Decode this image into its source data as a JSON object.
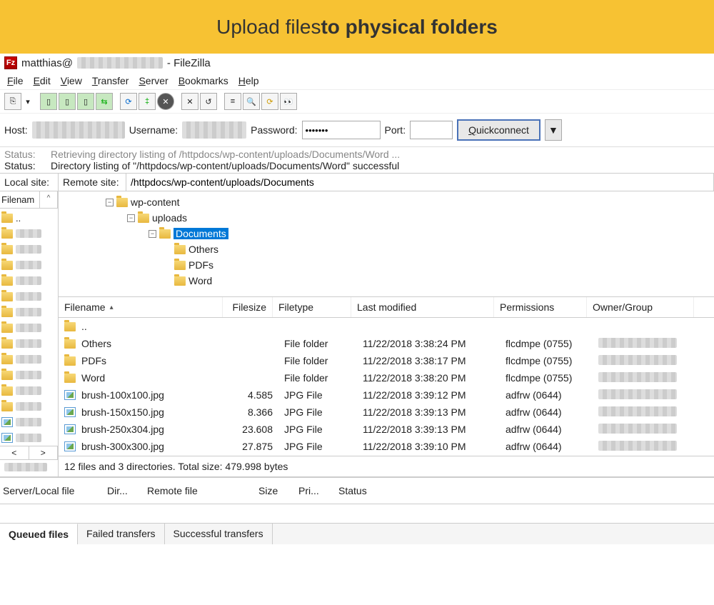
{
  "banner": {
    "text1": "Upload files ",
    "text2": "to physical folders"
  },
  "title": {
    "user": "matthias@",
    "app": " - FileZilla"
  },
  "menu": [
    "File",
    "Edit",
    "View",
    "Transfer",
    "Server",
    "Bookmarks",
    "Help"
  ],
  "connect": {
    "host_label": "Host:",
    "user_label": "Username:",
    "pass_label": "Password:",
    "pass_value": "•••••••",
    "port_label": "Port:",
    "quick": "Quickconnect",
    "dd": "▼"
  },
  "log": {
    "l1_label": "Status:",
    "l1_text": "Retrieving directory listing of /httpdocs/wp-content/uploads/Documents/Word ...",
    "l2_label": "Status:",
    "l2_text": "Directory listing of \"/httpdocs/wp-content/uploads/Documents/Word\" successful"
  },
  "sites": {
    "local_label": "Local site:",
    "remote_label": "Remote site:",
    "remote_value": "/httpdocs/wp-content/uploads/Documents"
  },
  "leftpane": {
    "head": "Filenam",
    "caret": "^",
    "updir": "..",
    "arrow_left": "<",
    "arrow_right": ">"
  },
  "tree": {
    "n1": "wp-content",
    "n2": "uploads",
    "n3": "Documents",
    "n4": "Others",
    "n5": "PDFs",
    "n6": "Word"
  },
  "columns": {
    "name": "Filename",
    "size": "Filesize",
    "type": "Filetype",
    "mod": "Last modified",
    "perm": "Permissions",
    "own": "Owner/Group"
  },
  "rows": [
    {
      "icon": "up",
      "name": "..",
      "size": "",
      "type": "",
      "mod": "",
      "perm": "",
      "own": ""
    },
    {
      "icon": "folder",
      "name": "Others",
      "size": "",
      "type": "File folder",
      "mod": "11/22/2018 3:38:24 PM",
      "perm": "flcdmpe (0755)",
      "own": "blur"
    },
    {
      "icon": "folder",
      "name": "PDFs",
      "size": "",
      "type": "File folder",
      "mod": "11/22/2018 3:38:17 PM",
      "perm": "flcdmpe (0755)",
      "own": "blur"
    },
    {
      "icon": "folder",
      "name": "Word",
      "size": "",
      "type": "File folder",
      "mod": "11/22/2018 3:38:20 PM",
      "perm": "flcdmpe (0755)",
      "own": "blur"
    },
    {
      "icon": "img",
      "name": "brush-100x100.jpg",
      "size": "4.585",
      "type": "JPG File",
      "mod": "11/22/2018 3:39:12 PM",
      "perm": "adfrw (0644)",
      "own": "blur"
    },
    {
      "icon": "img",
      "name": "brush-150x150.jpg",
      "size": "8.366",
      "type": "JPG File",
      "mod": "11/22/2018 3:39:13 PM",
      "perm": "adfrw (0644)",
      "own": "blur"
    },
    {
      "icon": "img",
      "name": "brush-250x304.jpg",
      "size": "23.608",
      "type": "JPG File",
      "mod": "11/22/2018 3:39:13 PM",
      "perm": "adfrw (0644)",
      "own": "blur"
    },
    {
      "icon": "img",
      "name": "brush-300x300.jpg",
      "size": "27.875",
      "type": "JPG File",
      "mod": "11/22/2018 3:39:10 PM",
      "perm": "adfrw (0644)",
      "own": "blur"
    }
  ],
  "status_remote": "12 files and 3 directories. Total size: 479.998 bytes",
  "queue_cols": {
    "c1": "Server/Local file",
    "c2": "Dir...",
    "c3": "Remote file",
    "c4": "Size",
    "c5": "Pri...",
    "c6": "Status"
  },
  "tabs": {
    "t1": "Queued files",
    "t2": "Failed transfers",
    "t3": "Successful transfers"
  }
}
